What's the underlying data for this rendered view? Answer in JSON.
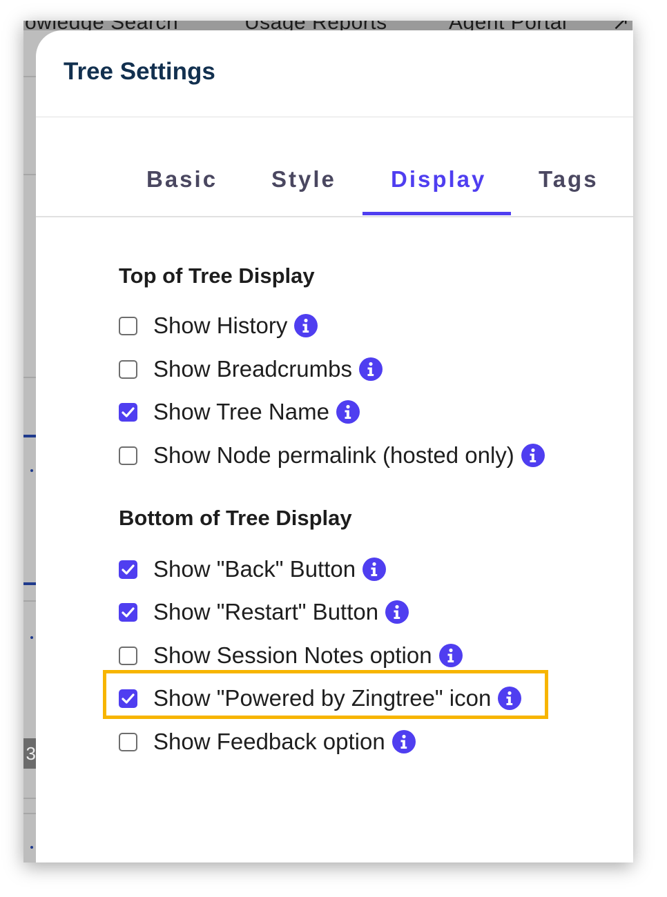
{
  "background_nav": {
    "items": [
      "owledge Search",
      "Usage Reports",
      "Agent Portal"
    ],
    "badge": "3"
  },
  "modal": {
    "title": "Tree Settings",
    "tabs": [
      {
        "label": "Basic",
        "active": false
      },
      {
        "label": "Style",
        "active": false
      },
      {
        "label": "Display",
        "active": true
      },
      {
        "label": "Tags",
        "active": false
      }
    ],
    "sections": [
      {
        "title": "Top of Tree Display",
        "options": [
          {
            "label": "Show History",
            "checked": false
          },
          {
            "label": "Show Breadcrumbs",
            "checked": false
          },
          {
            "label": "Show Tree Name",
            "checked": true
          },
          {
            "label": "Show Node permalink (hosted only)",
            "checked": false
          }
        ]
      },
      {
        "title": "Bottom of Tree Display",
        "options": [
          {
            "label": "Show \"Back\" Button",
            "checked": true
          },
          {
            "label": "Show \"Restart\" Button",
            "checked": true
          },
          {
            "label": "Show Session Notes option",
            "checked": false
          },
          {
            "label": "Show \"Powered by Zingtree\" icon",
            "checked": true,
            "highlighted": true
          },
          {
            "label": "Show Feedback option",
            "checked": false
          }
        ]
      }
    ]
  },
  "colors": {
    "accent": "#4f3ef0",
    "title": "#12304f",
    "highlight": "#f7b500"
  },
  "icons": {
    "info": "info-circle-icon",
    "check": "checkmark-icon"
  }
}
